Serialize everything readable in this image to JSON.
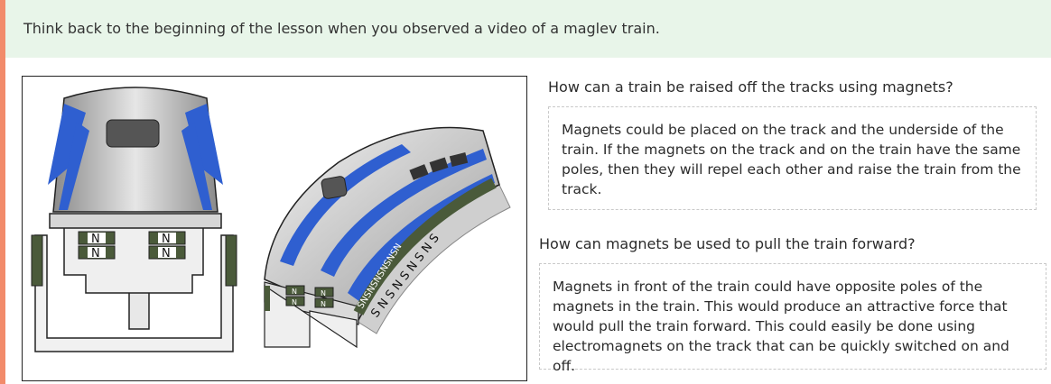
{
  "prompt": {
    "text": "Think back to the beginning of the lesson when you observed a video of a maglev train."
  },
  "figure": {
    "front_magnet_labels": [
      "N",
      "N",
      "N",
      "N"
    ],
    "side_magnet_labels": [
      "N",
      "N",
      "N",
      "N"
    ],
    "track_pattern_inner": "SNSNSNSNSNSN",
    "track_pattern_outer": "S N S N S N S N S"
  },
  "qa": [
    {
      "question": "How can a train be raised off the tracks using magnets?",
      "answer": "Magnets could be placed on the track and the underside of the train. If the magnets on the track and on the train have the same poles, then they will repel each other and raise the train from the track."
    },
    {
      "question": "How can magnets be used to pull the train forward?",
      "answer": "Magnets in front of the train could have opposite poles of the magnets in the train. This would produce an attractive force that would pull the train forward. This could easily be done using electromagnets on the track that can be quickly switched on and off."
    }
  ],
  "colors": {
    "accent": "#f28b6b",
    "banner_bg": "#e8f5e9",
    "train_blue": "#2f5fd0",
    "magnet_green": "#4a5a3a"
  }
}
